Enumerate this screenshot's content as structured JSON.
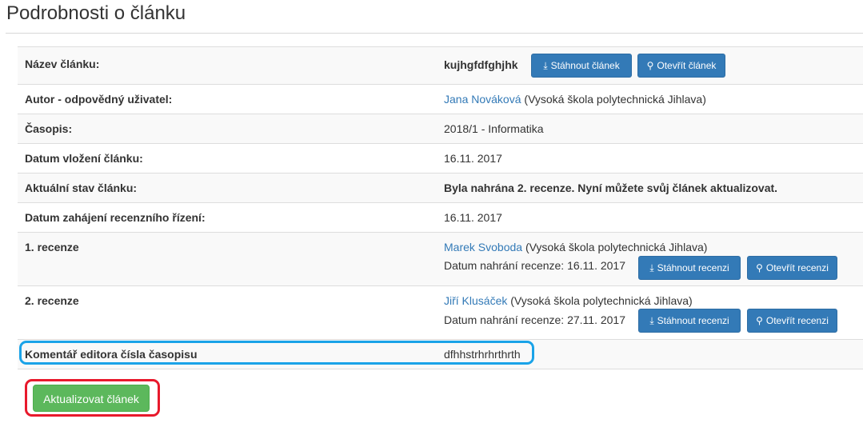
{
  "page": {
    "title": "Podrobnosti o článku"
  },
  "rows": {
    "title": {
      "label": "Název článku:",
      "value": "kujhgfdfghjhk",
      "download": "Stáhnout článek",
      "open": "Otevřít článek"
    },
    "author": {
      "label": "Autor - odpovědný uživatel:",
      "name": "Jana Nováková",
      "org": " (Vysoká škola polytechnická Jihlava)"
    },
    "journal": {
      "label": "Časopis:",
      "value": "2018/1 - Informatika"
    },
    "inserted": {
      "label": "Datum vložení článku:",
      "value": "16.11. 2017"
    },
    "state": {
      "label": "Aktuální stav článku:",
      "value": "Byla nahrána 2. recenze. Nyní můžete svůj článek aktualizovat."
    },
    "review_start": {
      "label": "Datum zahájení recenzního řízení:",
      "value": "16.11. 2017"
    },
    "review1": {
      "label": "1. recenze",
      "name": "Marek Svoboda",
      "org": " (Vysoká škola polytechnická Jihlava)",
      "date": "Datum nahrání recenze: 16.11. 2017",
      "download": "Stáhnout recenzi",
      "open": "Otevřít recenzi"
    },
    "review2": {
      "label": "2. recenze",
      "name": "Jiří Klusáček",
      "org": " (Vysoká škola polytechnická Jihlava)",
      "date": "Datum nahrání recenze: 27.11. 2017",
      "download": "Stáhnout recenzi",
      "open": "Otevřít recenzi"
    },
    "comment": {
      "label": "Komentář editora čísla časopisu",
      "value": "dfhhstrhrhrthrth"
    }
  },
  "actions": {
    "update": "Aktualizovat článek"
  },
  "icons": {
    "download": "download-icon",
    "open": "search-icon"
  },
  "colors": {
    "primary": "#337ab7",
    "success": "#5cb85c",
    "highlight_blue": "#1aa3e8",
    "highlight_red": "#e8192c"
  }
}
